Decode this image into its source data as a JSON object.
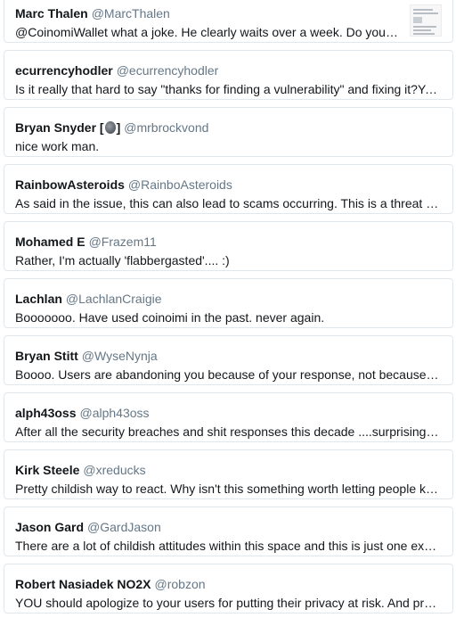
{
  "replies": [
    {
      "display_name": "Marc Thalen",
      "handle": "@MarcThalen",
      "text": "@CoinomiWallet what a joke. He clearly waits over a week. Do you really think it's reasonable to keep blaming the reporter?",
      "has_thumbnail": true
    },
    {
      "display_name": "ecurrencyhodler",
      "handle": "@ecurrencyhodler",
      "text": "Is it really that hard to say \"thanks for finding a vulnerability\" and fixing it?You guys are making this so much worse than it needs to be."
    },
    {
      "display_name": "Bryan Snyder [",
      "display_name_suffix": "]",
      "handle": "@mrbrockvond",
      "text": "nice work man."
    },
    {
      "display_name": "RainbowAsteroids",
      "handle": "@RainboAsteroids",
      "text": "As said in the issue, this can also lead to scams occurring. This is a threat to every user of the wallet."
    },
    {
      "display_name": "Mohamed E",
      "handle": "@Frazem11",
      "text": "Rather, I'm actually 'flabbergasted'.... :)"
    },
    {
      "display_name": "Lachlan",
      "handle": "@LachlanCraigie",
      "text": "Booooooo. Have used coinoimi in the past. never again."
    },
    {
      "display_name": "Bryan Stitt",
      "handle": "@WyseNynja",
      "text": "Boooo. Users are abandoning you because of your response, not because of the bug itself."
    },
    {
      "display_name": "alph43oss",
      "handle": "@alph43oss",
      "text": "After all the security breaches and shit responses this decade ....surprising nobody at this point."
    },
    {
      "display_name": "Kirk Steele",
      "handle": "@xreducks",
      "text": "Pretty childish way to react. Why isn't this something worth letting people know about?"
    },
    {
      "display_name": "Jason Gard",
      "handle": "@GardJason",
      "text": "There are a lot of childish attitudes within this space and this is just one example of it."
    },
    {
      "display_name": "Robert Nasiadek NO2X",
      "handle": "@robzon",
      "text": "YOU should apologize to your users for putting their privacy at risk. And provide a fix."
    }
  ],
  "colors": {
    "name": "#14171a",
    "handle": "#657786",
    "border": "#e1e8ed"
  }
}
